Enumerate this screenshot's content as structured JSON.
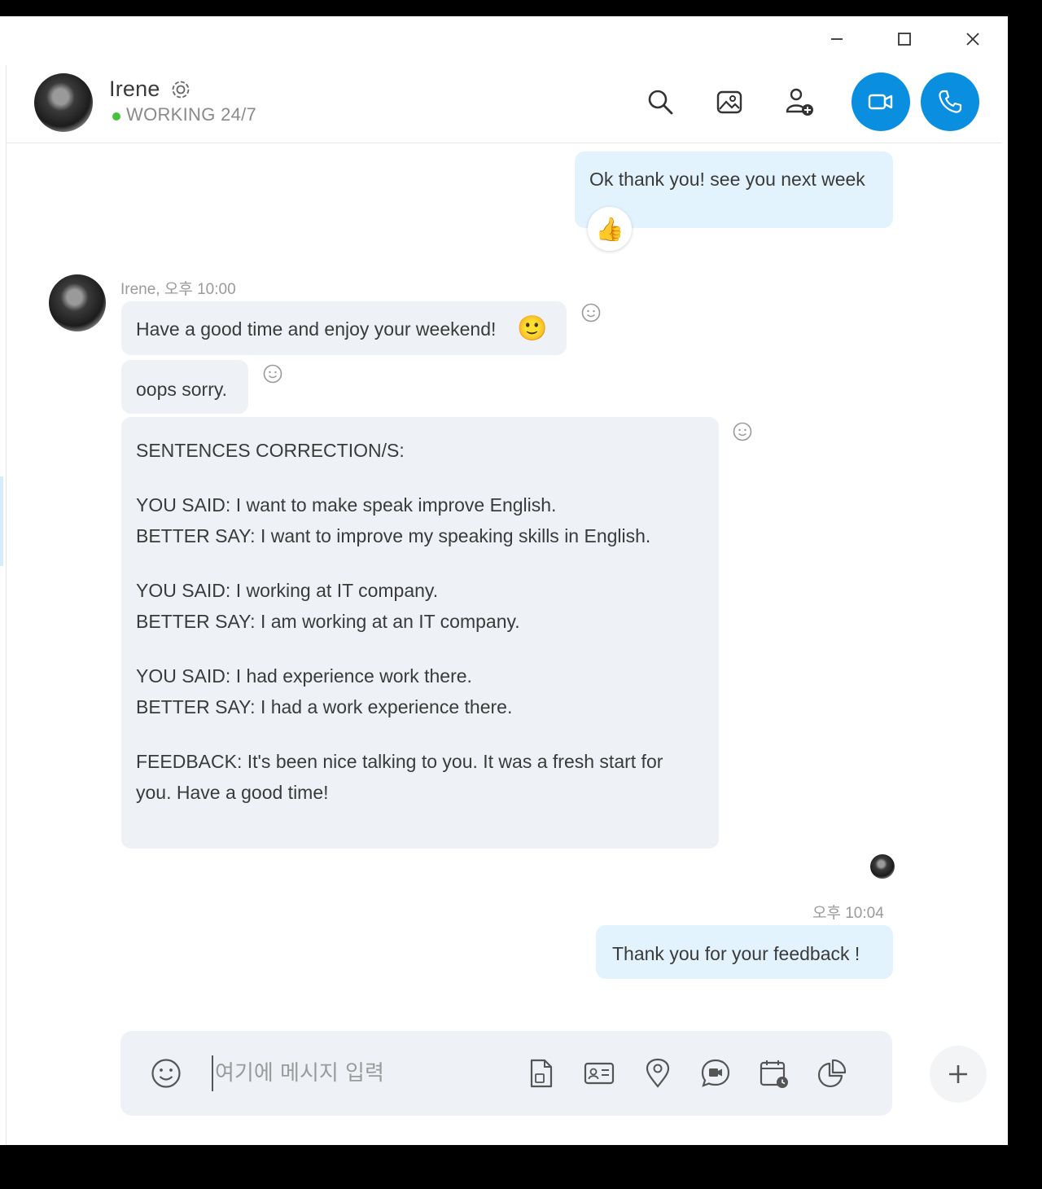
{
  "window_controls": {
    "minimize": "minimize",
    "maximize": "maximize",
    "close": "close"
  },
  "header": {
    "contact_name": "Irene",
    "status": "WORKING 24/7",
    "status_color": "#46c03e",
    "icons": [
      "search-icon",
      "gallery-icon",
      "add-person-icon",
      "video-call-icon",
      "audio-call-icon"
    ],
    "call_button_color": "#0a8fe0"
  },
  "messages": {
    "m1": {
      "text": "Ok thank you! see you next week",
      "reaction": "👍"
    },
    "m2_meta": "Irene, 오후 10:00",
    "m2": {
      "text": "Have a good time and enjoy your weekend!",
      "emoji": "🙂"
    },
    "m3": {
      "text": "oops sorry."
    },
    "m4": {
      "title": "SENTENCES CORRECTION/S:",
      "s1_said": "YOU SAID: I want to make speak improve English.",
      "s1_better": "BETTER SAY: I want to improve my speaking skills in English.",
      "s2_said": "YOU SAID: I working at IT company.",
      "s2_better": "BETTER SAY: I am working at an IT company.",
      "s3_said": "YOU SAID: I had experience work there.",
      "s3_better": "BETTER SAY: I had a work experience there.",
      "feedback": "FEEDBACK: It's been nice talking to you. It was a fresh start for you. Have a good time!"
    },
    "m5_meta": "오후 10:04",
    "m5": {
      "text": "Thank you for your feedback !"
    }
  },
  "composer": {
    "placeholder": "여기에 메시지 입력",
    "icons": [
      "emoji-icon",
      "file-icon",
      "contact-card-icon",
      "location-icon",
      "video-message-icon",
      "schedule-icon",
      "poll-icon",
      "plus-icon"
    ]
  }
}
